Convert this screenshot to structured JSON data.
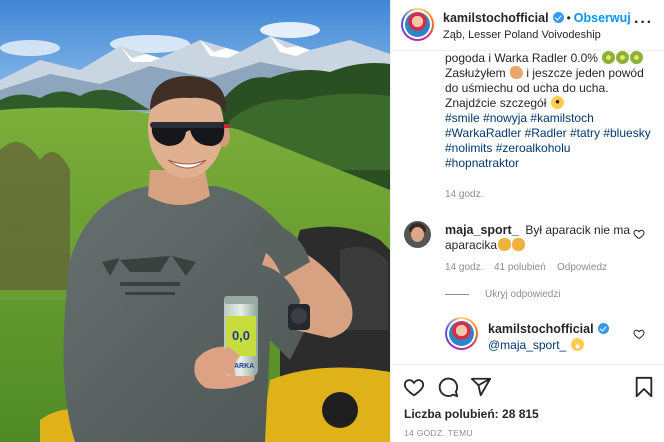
{
  "post": {
    "username": "kamilstochofficial",
    "separator": "•",
    "follow_label": "Obserwuj",
    "location": "Ząb, Lesser Poland Voivodeship",
    "more_label": "···"
  },
  "caption": {
    "line0": "pogoda i Warka Radler 0.0%",
    "line1a": "Zasłużyłem",
    "line1b": "i jeszcze jeden powód",
    "line2": "do uśmiechu od ucha do ucha.",
    "line3": "Znajdźcie szczegół",
    "tags_line1": [
      "#smile",
      "#nowyja",
      "#kamilstoch"
    ],
    "tags_line2": [
      "#WarkaRadler",
      "#Radler",
      "#tatry",
      "#bluesky"
    ],
    "tags_line3": [
      "#nolimits",
      "#zeroalkoholu"
    ],
    "tags_line4": [
      "#hopnatraktor"
    ],
    "time": "14 godz."
  },
  "comment": {
    "username": "maja_sport_",
    "text1": "Był aparacik nie ma",
    "text2": "aparacika",
    "time": "14 godz.",
    "likes": "41 polubień",
    "reply_label": "Odpowiedz",
    "hide_replies_label": "Ukryj odpowiedzi"
  },
  "reply": {
    "username": "kamilstochofficial",
    "mention": "@maja_sport_"
  },
  "footer": {
    "likes_label": "Liczba polubień:",
    "likes_count": "28 815",
    "posted": "14 GODZ. TEMU"
  },
  "photo": {
    "can_text_top": "0,0",
    "can_text_brand": "WARKA"
  },
  "icon_names": [
    "heart-icon",
    "comment-icon",
    "share-icon",
    "bookmark-icon",
    "verified-icon",
    "more-icon"
  ],
  "colors": {
    "link": "#00376b",
    "follow": "#0095f6",
    "verified": "#3897f0",
    "meta": "#8e8e8e"
  }
}
